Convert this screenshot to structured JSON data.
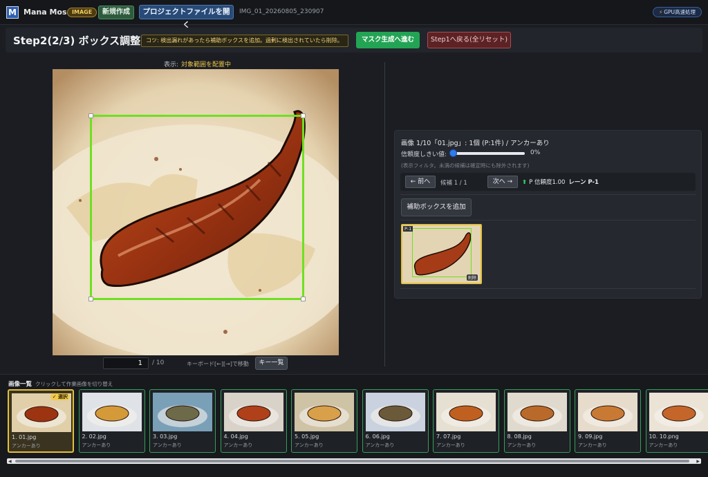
{
  "header": {
    "app_name": "Mana Mosaic",
    "mode_badge": "IMAGE",
    "new_button": "新規作成",
    "open_button": "プロジェクトファイルを開く",
    "project_id": "IMG_01_20260805_230907",
    "gpu_badge": "GPU高速処理",
    "gpu_icon": "lightning-icon"
  },
  "step": {
    "title": "Step2(2/3) ボックス調整",
    "tip": "コツ: 検出漏れがあったら補助ボックスを追加。過剰に検出されていたら削除。",
    "mask_button": "マスク生成へ進む",
    "back_button": "Step1へ戻る(全リセット)"
  },
  "viewer": {
    "display_label": "表示:",
    "display_value": "対象範囲を配置中",
    "page_current": "1",
    "page_total": "/ 10",
    "keyboard_hint": "キーボード[←][→]で移動",
    "keys_button": "キー一覧"
  },
  "panel": {
    "info": "画像 1/10「01.jpg」: 1個 (P:1件) / アンカーあり",
    "threshold_label": "信頼度しきい値:",
    "threshold_value": "0%",
    "threshold_fraction": 0,
    "filter_note": "(表示フィルタ。未満の候補は確定時にも除外されます)",
    "prev_button": "← 前へ",
    "candidate_text": "候補 1 / 1",
    "next_button": "次へ →",
    "confidence_text": "P 信頼度1.00",
    "lane_text": "レーン P-1",
    "add_button": "補助ボックスを追加",
    "thumb_label": "P-1",
    "delete_label": "削除"
  },
  "strip": {
    "title": "画像一覧",
    "hint": "クリックして作業画像を切り替え",
    "selected_badge": "✓ 選択",
    "items": [
      {
        "name": "1. 01.jpg",
        "sub": "アンカーあり"
      },
      {
        "name": "2. 02.jpg",
        "sub": "アンカーあり"
      },
      {
        "name": "3. 03.jpg",
        "sub": "アンカーあり"
      },
      {
        "name": "4. 04.jpg",
        "sub": "アンカーあり"
      },
      {
        "name": "5. 05.jpg",
        "sub": "アンカーあり"
      },
      {
        "name": "6. 06.jpg",
        "sub": "アンカーあり"
      },
      {
        "name": "7. 07.jpg",
        "sub": "アンカーあり"
      },
      {
        "name": "8. 08.jpg",
        "sub": "アンカーあり"
      },
      {
        "name": "9. 09.jpg",
        "sub": "アンカーあり"
      },
      {
        "name": "10. 10.png",
        "sub": "アンカーあり"
      }
    ]
  },
  "colors": {
    "accent_green": "#23a455",
    "bbox_green": "#6ee021",
    "select_yellow": "#e3c13c",
    "danger_red": "#b14a4f"
  }
}
